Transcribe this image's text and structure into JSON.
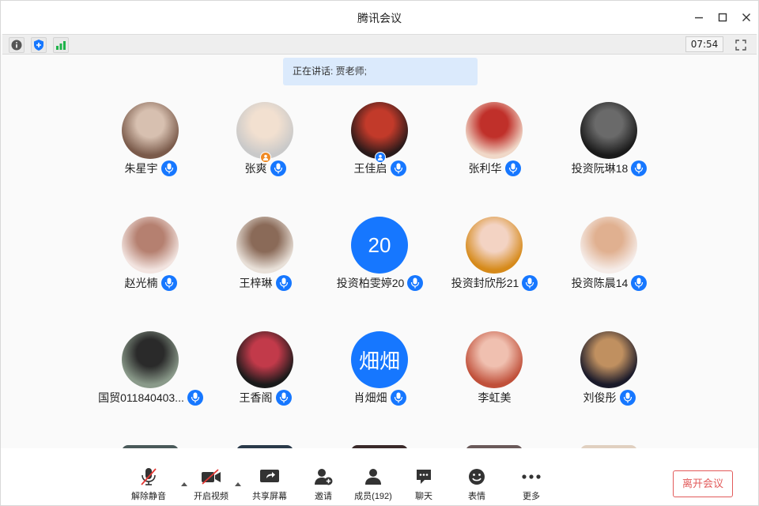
{
  "window": {
    "title": "腾讯会议"
  },
  "toolbar": {
    "timer": "07:54"
  },
  "speaking_banner": "正在讲话: 贾老师;",
  "participants": [
    {
      "name": "朱星宇",
      "avatar": "photo",
      "avatar_colors": [
        "#7a5a4a",
        "#d7c0b0"
      ],
      "mic": true,
      "host": false
    },
    {
      "name": "张爽",
      "avatar": "photo",
      "avatar_colors": [
        "#c9c9c9",
        "#f2e0d0"
      ],
      "mic": true,
      "host": true,
      "host_color": "#f08a24"
    },
    {
      "name": "王佳启",
      "avatar": "photo",
      "avatar_colors": [
        "#2a1a1a",
        "#c23a2a"
      ],
      "mic": true,
      "host": true,
      "host_color": "#1677ff"
    },
    {
      "name": "张利华",
      "avatar": "photo",
      "avatar_colors": [
        "#f0d8c8",
        "#c0302a"
      ],
      "mic": true,
      "host": false
    },
    {
      "name": "投资阮琳18",
      "avatar": "photo",
      "avatar_colors": [
        "#1a1a1a",
        "#6a6a6a"
      ],
      "mic": true,
      "host": false
    },
    {
      "name": "赵光楠",
      "avatar": "photo",
      "avatar_colors": [
        "#f2e4e0",
        "#b58070"
      ],
      "mic": true,
      "host": false
    },
    {
      "name": "王梓琳",
      "avatar": "photo",
      "avatar_colors": [
        "#e8e0d8",
        "#8a6a58"
      ],
      "mic": true,
      "host": false
    },
    {
      "name": "投资柏雯婷20",
      "avatar": "text",
      "avatar_text": "20",
      "mic": true,
      "host": false
    },
    {
      "name": "投资封欣彤21",
      "avatar": "photo",
      "avatar_colors": [
        "#d68a1a",
        "#f3d3c3"
      ],
      "mic": true,
      "host": false
    },
    {
      "name": "投资陈晨14",
      "avatar": "photo",
      "avatar_colors": [
        "#f5ece8",
        "#e0b090"
      ],
      "mic": true,
      "host": false
    },
    {
      "name": "国贸011840403...",
      "avatar": "photo",
      "avatar_colors": [
        "#8a9a8a",
        "#2a2a2a"
      ],
      "mic": true,
      "host": false
    },
    {
      "name": "王香阁",
      "avatar": "photo",
      "avatar_colors": [
        "#1a1a1a",
        "#c23a4a"
      ],
      "mic": true,
      "host": false
    },
    {
      "name": "肖畑畑",
      "avatar": "text",
      "avatar_text": "畑畑",
      "mic": true,
      "host": false
    },
    {
      "name": "李虹美",
      "avatar": "photo",
      "avatar_colors": [
        "#c0503a",
        "#f0c0b0"
      ],
      "mic": false,
      "host": false
    },
    {
      "name": "刘俊彤",
      "avatar": "photo",
      "avatar_colors": [
        "#1a1a2a",
        "#c09060"
      ],
      "mic": true,
      "host": false
    }
  ],
  "controls": [
    {
      "label": "解除静音",
      "icon": "mic-muted-icon"
    },
    {
      "label": "开启视频",
      "icon": "video-off-icon"
    },
    {
      "label": "共享屏幕",
      "icon": "share-screen-icon"
    },
    {
      "label": "邀请",
      "icon": "invite-icon"
    },
    {
      "label": "成员(192)",
      "icon": "members-icon"
    },
    {
      "label": "聊天",
      "icon": "chat-icon"
    },
    {
      "label": "表情",
      "icon": "emoji-icon"
    },
    {
      "label": "更多",
      "icon": "more-icon"
    }
  ],
  "leave_label": "离开会议",
  "colors": {
    "accent": "#1677ff",
    "danger": "#e25a5a",
    "banner": "#dbeafc"
  }
}
